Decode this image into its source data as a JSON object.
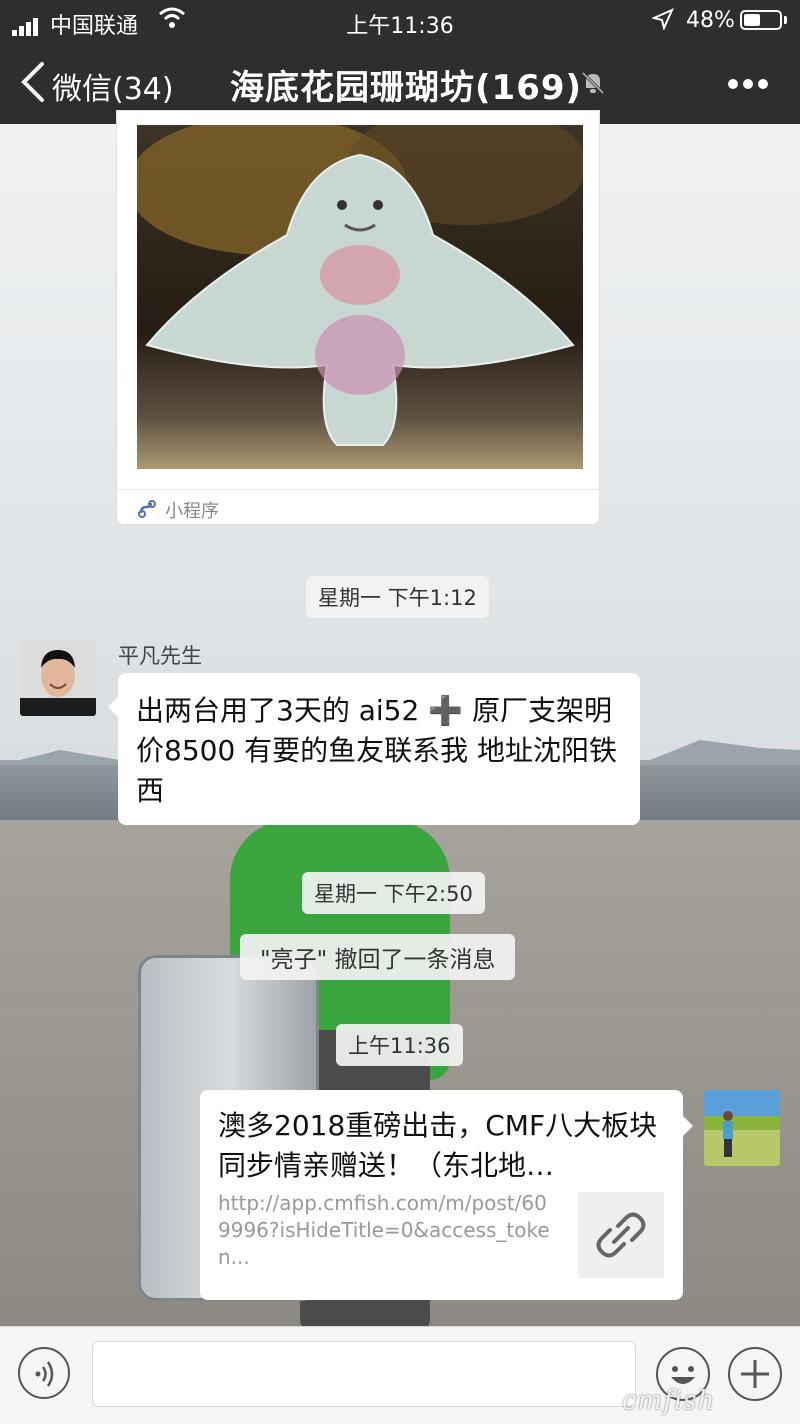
{
  "status_bar": {
    "carrier": "中国联通",
    "time": "上午11:36",
    "battery": "48%",
    "battery_level": 0.48
  },
  "nav": {
    "back_label": "微信(34)",
    "title": "海底花园珊瑚坊(169)"
  },
  "mini_program_card": {
    "label": "小程序"
  },
  "timestamps": [
    "星期一 下午1:12",
    "星期一 下午2:50",
    "上午11:36"
  ],
  "messages": [
    {
      "sender": "平凡先生",
      "text": "出两台用了3天的 ai52 ➕ 原厂支架明价8500 有要的鱼友联系我 地址沈阳铁西"
    }
  ],
  "recall_notice": "\"亮子\" 撤回了一条消息",
  "link_message": {
    "title": "澳多2018重磅出击，CMF八大板块同步情亲赠送！（东北地…",
    "url": "http://app.cmfish.com/m/post/609996?isHideTitle=0&access_token..."
  },
  "watermark": "cmfish"
}
